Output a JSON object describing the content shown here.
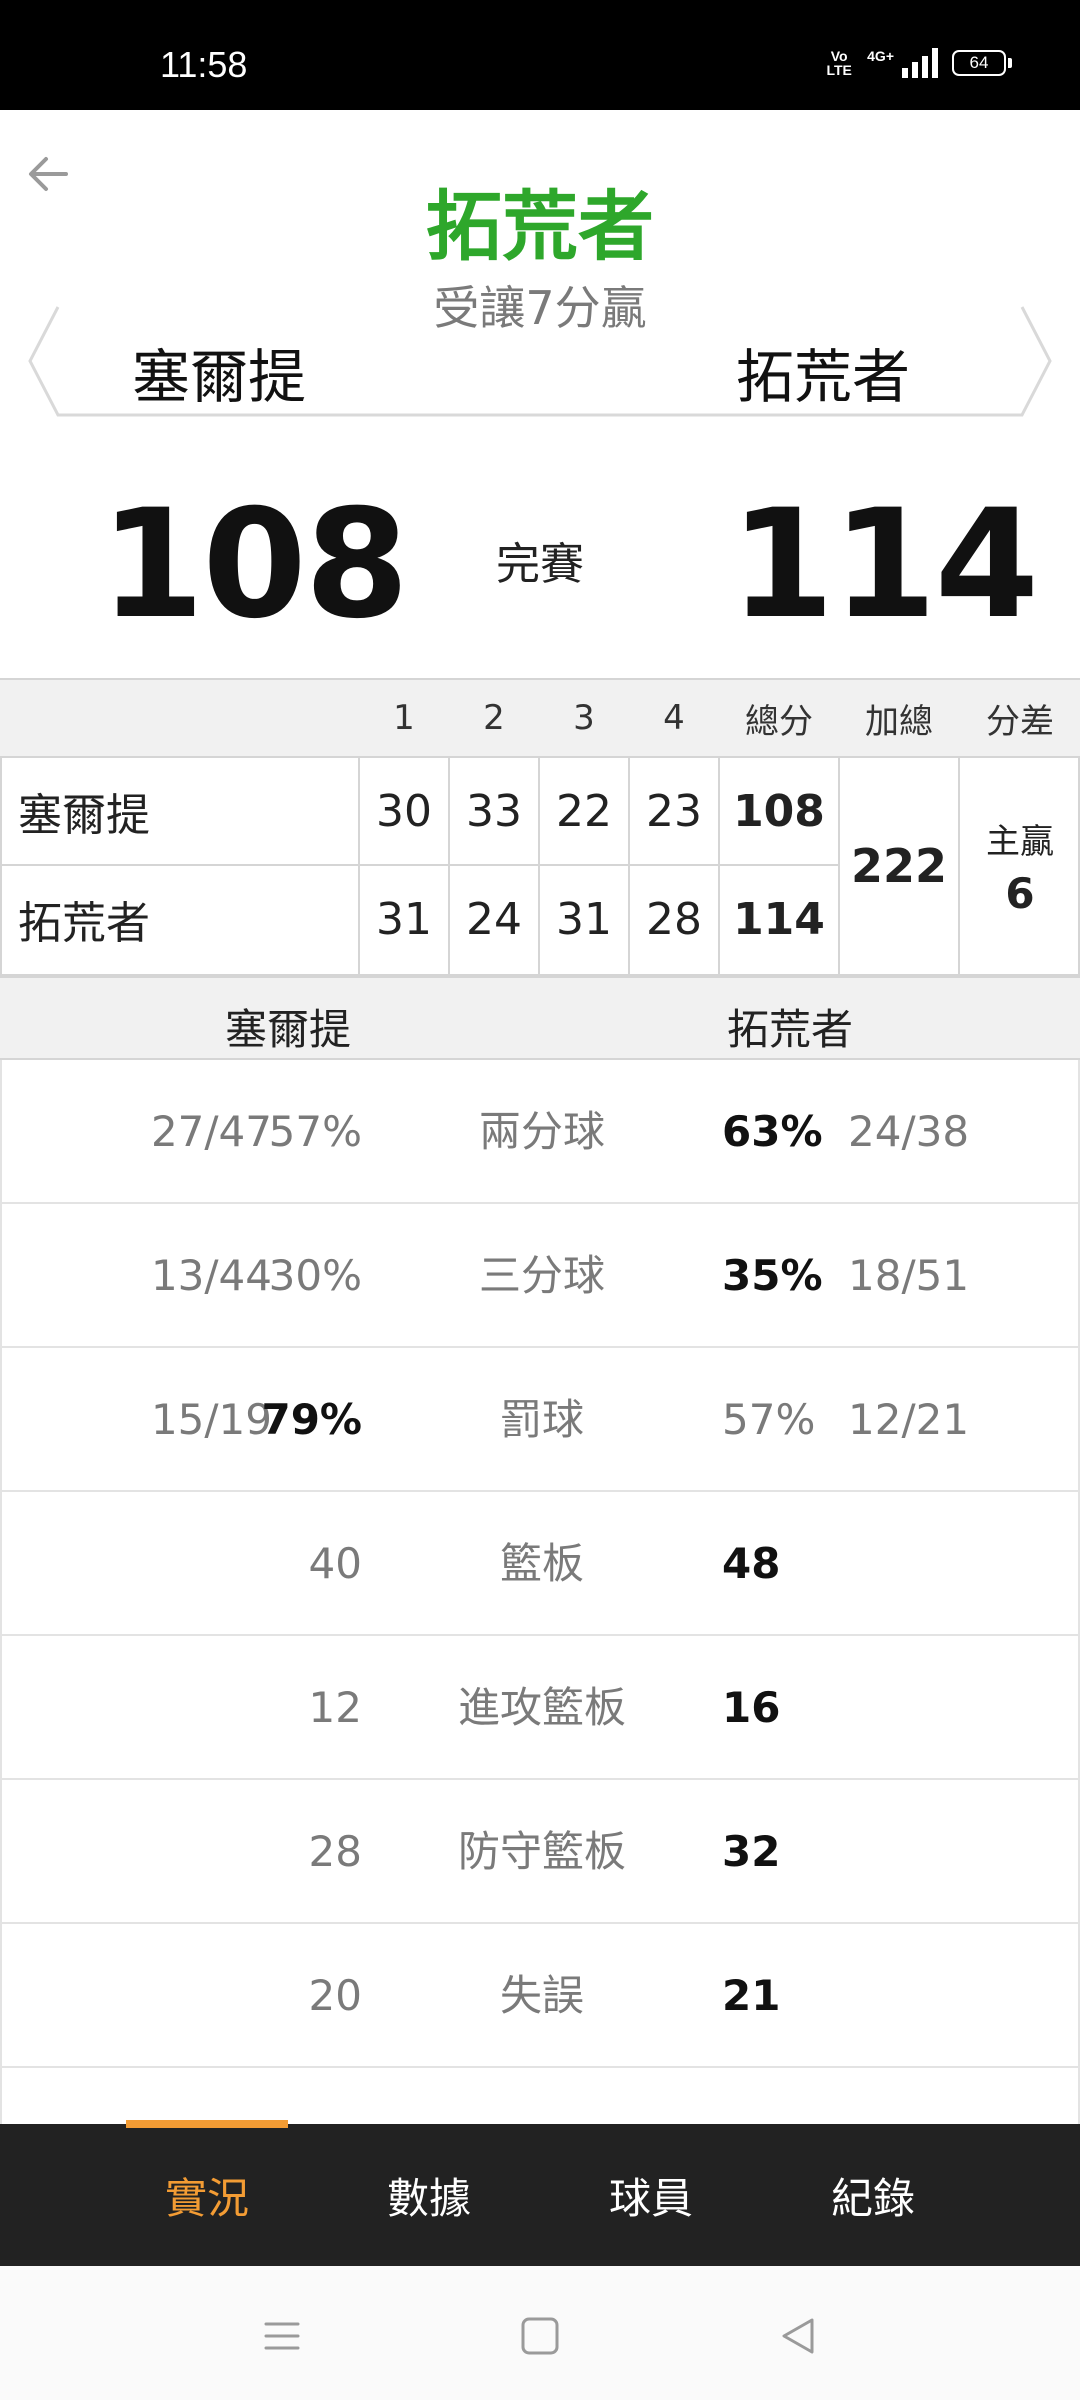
{
  "status_bar": {
    "time": "11:58",
    "volte_label": "Vo LTE",
    "network_label": "4G+",
    "battery": "64"
  },
  "header": {
    "back_icon": "arrow-left-icon",
    "winner": "拓荒者",
    "handicap_result": "受讓7分贏",
    "away_team": "塞爾提",
    "home_team": "拓荒者"
  },
  "score": {
    "away": "108",
    "home": "114",
    "status": "完賽"
  },
  "quarter_table": {
    "headers": [
      "1",
      "2",
      "3",
      "4",
      "總分",
      "加總",
      "分差"
    ],
    "rows": [
      {
        "team": "塞爾提",
        "q": [
          "30",
          "33",
          "22",
          "23"
        ],
        "total": "108"
      },
      {
        "team": "拓荒者",
        "q": [
          "31",
          "24",
          "31",
          "28"
        ],
        "total": "114"
      }
    ],
    "combined_total": "222",
    "diff_label": "主贏",
    "diff_value": "6"
  },
  "stats": {
    "away_team": "塞爾提",
    "home_team": "拓荒者",
    "rows": [
      {
        "label": "兩分球",
        "away_frac": "27/47",
        "away_pct": "57%",
        "home_pct": "63%",
        "home_frac": "24/38",
        "highlight": "home"
      },
      {
        "label": "三分球",
        "away_frac": "13/44",
        "away_pct": "30%",
        "home_pct": "35%",
        "home_frac": "18/51",
        "highlight": "home"
      },
      {
        "label": "罰球",
        "away_frac": "15/19",
        "away_pct": "79%",
        "home_pct": "57%",
        "home_frac": "12/21",
        "highlight": "away"
      },
      {
        "label": "籃板",
        "away_val": "40",
        "home_val": "48",
        "highlight": "home"
      },
      {
        "label": "進攻籃板",
        "away_val": "12",
        "home_val": "16",
        "highlight": "home"
      },
      {
        "label": "防守籃板",
        "away_val": "28",
        "home_val": "32",
        "highlight": "home"
      },
      {
        "label": "失誤",
        "away_val": "20",
        "home_val": "21",
        "highlight": "home"
      }
    ]
  },
  "tabs": [
    {
      "label": "實況",
      "active": true
    },
    {
      "label": "數據",
      "active": false
    },
    {
      "label": "球員",
      "active": false
    },
    {
      "label": "紀錄",
      "active": false
    }
  ],
  "colors": {
    "winner_green": "#2ea72b",
    "active_tab": "#f39c34",
    "tab_bar_bg": "#222222"
  }
}
